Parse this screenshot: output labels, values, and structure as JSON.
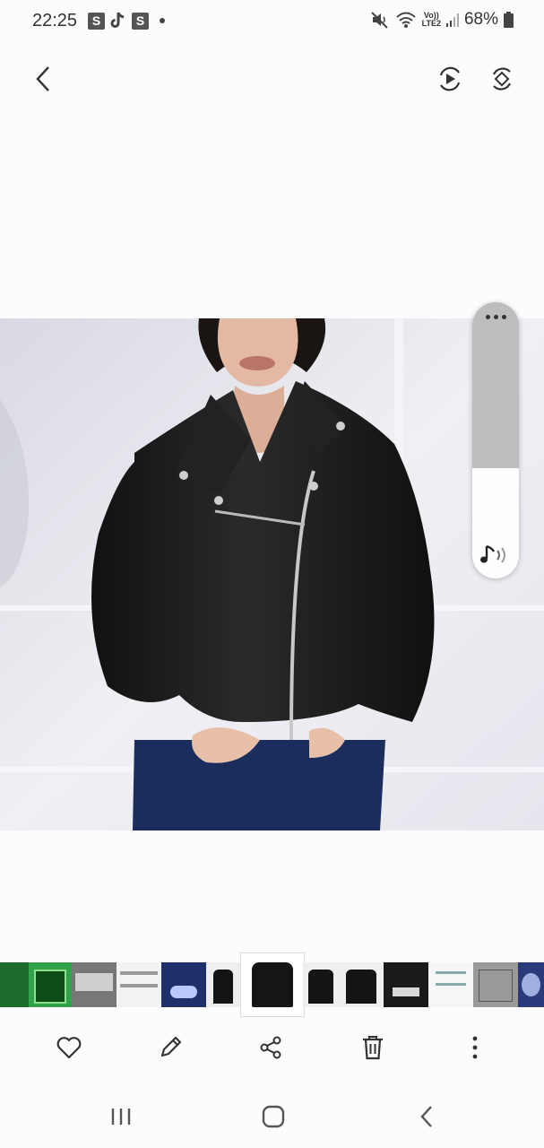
{
  "status_bar": {
    "time": "22:25",
    "notif_icons": [
      "S",
      "tiktok-icon",
      "S"
    ],
    "network": "LTE2",
    "volte": "Vo))",
    "battery": "68%"
  },
  "top_bar": {
    "back": "back-icon",
    "actions": [
      "motion-photo-icon",
      "rotate-icon"
    ]
  },
  "volume_panel": {
    "level_percent": 40,
    "stream": "music-icon"
  },
  "thumbnails": {
    "count": 14,
    "selected_index": 6
  },
  "actions": [
    "favorite-icon",
    "edit-icon",
    "share-icon",
    "delete-icon",
    "more-icon"
  ],
  "nav": [
    "recents-icon",
    "home-icon",
    "back-icon"
  ]
}
